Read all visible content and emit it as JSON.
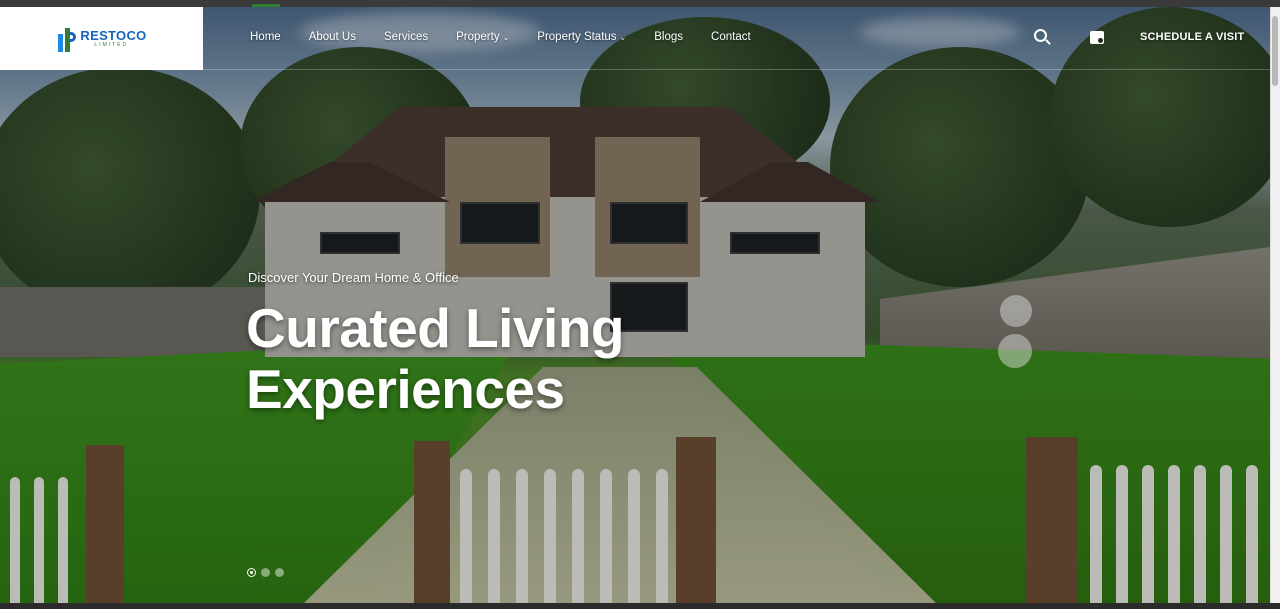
{
  "brand": {
    "name": "RESTOCO",
    "subtitle": "LIMITED"
  },
  "nav": {
    "items": [
      {
        "label": "Home",
        "has_dropdown": false
      },
      {
        "label": "About Us",
        "has_dropdown": false
      },
      {
        "label": "Services",
        "has_dropdown": false
      },
      {
        "label": "Property",
        "has_dropdown": true
      },
      {
        "label": "Property Status",
        "has_dropdown": true
      },
      {
        "label": "Blogs",
        "has_dropdown": false
      },
      {
        "label": "Contact",
        "has_dropdown": false
      }
    ],
    "search_icon": "search-icon",
    "calendar_icon": "calendar-icon",
    "cta_label": "SCHEDULE A VISIT"
  },
  "hero": {
    "kicker": "Discover Your Dream Home & Office",
    "title_line1": "Curated Living",
    "title_line2": "Experiences"
  },
  "slider": {
    "count": 3,
    "active_index": 0
  },
  "colors": {
    "brand_blue": "#1565c0",
    "brand_green": "#2e7d32",
    "text_white": "#ffffff"
  }
}
